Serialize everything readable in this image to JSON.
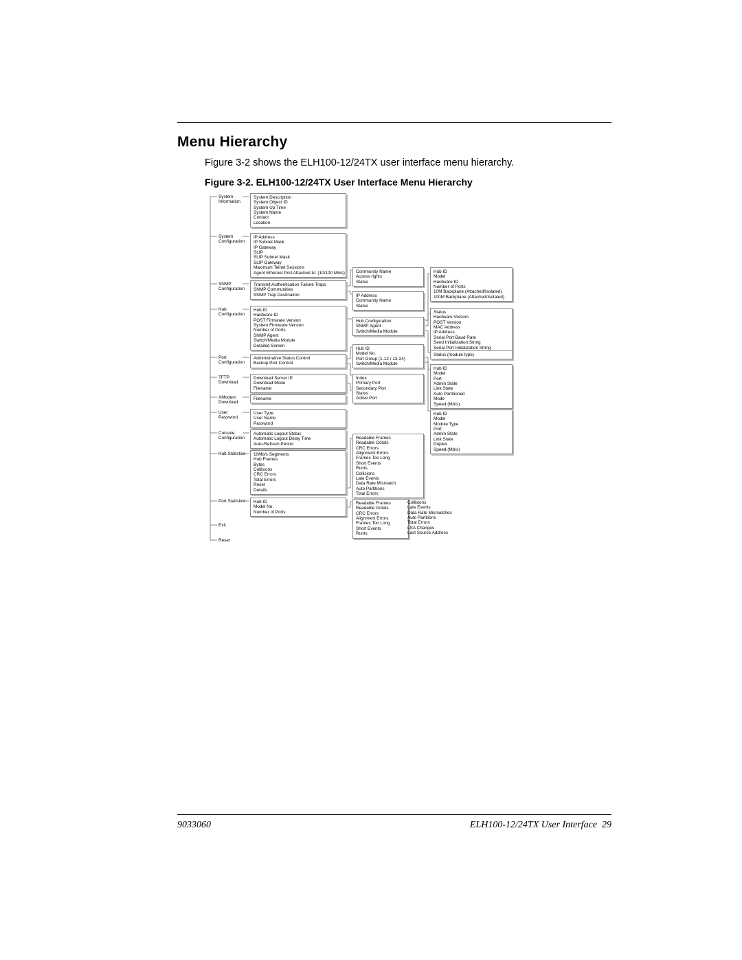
{
  "title": "Menu Hierarchy",
  "intro": "Figure 3-2 shows the ELH100-12/24TX user interface menu hierarchy.",
  "figcap": "Figure 3-2.  ELH100-12/24TX User Interface Menu Hierarchy",
  "footer_left": "9033060",
  "footer_right_text": "ELH100-12/24TX User Interface",
  "footer_right_page": "29",
  "root_menu": [
    "System Information",
    "System Configuration",
    "SNMP Configuration",
    "Hub Configuration",
    "Port Configuration",
    "TFTP Download",
    "XModem Download",
    "User Password",
    "Console Configuration",
    "Hub Statistics",
    "Port Statistics",
    "Exit",
    "Reset"
  ],
  "b_sysinfo": [
    "System Description",
    "System Object ID",
    "System Up Time",
    "System Name",
    "Contact",
    "Location"
  ],
  "b_syscfg": [
    "IP Address",
    "IP Subnet Mask",
    "IP Gateway",
    "SLIP",
    "SLIP Subnet Mask",
    "SLIP Gateway",
    "Maximum Telnet Sessions",
    "Agent Ethernet Port Attached to: (10/100 Mb/s)"
  ],
  "b_snmp": [
    "Transmit Authentication Failure Traps",
    "SNMP Communities",
    "SNMP Trap Destination"
  ],
  "b_hubcfg": [
    "Hub ID",
    "Hardware ID",
    "POST Firmware Version",
    "System Firmware Version",
    "Number of Ports",
    "SNMP Agent",
    "Switch/Media Module",
    "Detailed Screen"
  ],
  "b_portcfg": [
    "Administrative Status Control",
    "Backup Port Control"
  ],
  "b_tftp": [
    "Download Server IP",
    "Download Mode",
    "Filename"
  ],
  "b_xmodem": [
    "Filename"
  ],
  "b_user": [
    "User Type",
    "User Name",
    "Password"
  ],
  "b_console": [
    "Automatic Logout Status",
    "Automatic Logout Delay Time",
    "Auto-Refresh Period"
  ],
  "b_hubstat": [
    "10Mb/s Segments",
    "Hub Frames",
    "Bytes",
    "Collisions",
    "CRC Errors",
    "Total Errors",
    "Reset",
    "Details"
  ],
  "b_portstat": [
    "Hub ID",
    "Model No.",
    "Number of Ports"
  ],
  "b_snmp_comm": [
    "Community Name",
    "Access rights",
    "Status"
  ],
  "b_snmp_trap": [
    "IP Address",
    "Community Name",
    "Status"
  ],
  "b_hub_sub": [
    "Hub Configuration",
    "SNMP Agent",
    "Switch/Media Module"
  ],
  "b_port_sub": [
    "Hub ID",
    "Model No.",
    "Port Group (1-12 / 13-24)",
    "Switch/Media Module"
  ],
  "b_backup": [
    "Index",
    "Primary Port",
    "Secondary Port",
    "Status",
    "Active Port"
  ],
  "b_hubstat_det": [
    "Readable Frames",
    "Readable Octets",
    "CRC Errors",
    "Alignment Errors",
    "Frames Too Long",
    "Short Events",
    "Runts",
    "Collisions",
    "Late Events",
    "Data Rate Mismatch",
    "Auto Partitions",
    "Total Errors"
  ],
  "b_portstat_det1": [
    "Readable Frames",
    "Readable Octets",
    "CRC Errors",
    "Alignment Errors",
    "Frames Too Long",
    "Short Events",
    "Runts"
  ],
  "b_portstat_det2": [
    "Collisions",
    "Late Events",
    "Data Rate Mismatches",
    "Auto Partitions",
    "Total Errors",
    "LSA Changes",
    "Last Source Address"
  ],
  "b_r_hubid": [
    "Hub ID",
    "Model",
    "Hardware ID",
    "Number of Ports",
    "10M Backplane (Attached/Isolated)",
    "100M Backplane (Attached/Isolated)"
  ],
  "b_r_snmpagent": [
    "Status",
    "Hardware Version",
    "POST Version",
    "MAC Address",
    "IP Address",
    "Serial Port Baud Rate",
    "Send Initialization String",
    "Serial Port Initialization String"
  ],
  "b_r_modtype": [
    "Status (module type)"
  ],
  "b_r_portgroup": [
    "Hub ID",
    "Model",
    "Port",
    "Admin State",
    "Link State",
    "Auto Partitioned",
    "Mode",
    "Speed (Mb/s)"
  ],
  "b_r_swmedia": [
    "Hub ID",
    "Model",
    "Module Type",
    "Port",
    "Admin State",
    "Link State",
    "Duplex",
    "Speed (Mb/s)"
  ]
}
